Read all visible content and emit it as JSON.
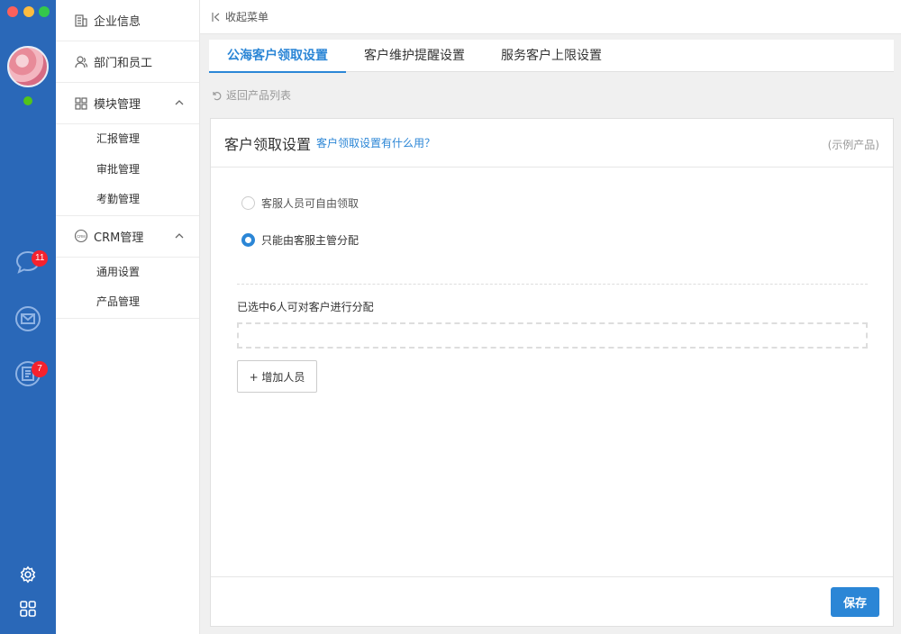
{
  "window": {
    "controls": [
      "close",
      "minimize",
      "zoom"
    ]
  },
  "rail": {
    "icons": [
      {
        "name": "chat-icon",
        "badge": "11"
      },
      {
        "name": "mail-icon",
        "badge": ""
      },
      {
        "name": "notes-icon",
        "badge": "7"
      }
    ],
    "bottom_icons": [
      "gear-icon",
      "apps-grid-icon"
    ],
    "status": "online"
  },
  "menu": {
    "items": [
      {
        "label": "企业信息",
        "icon": "building-icon"
      },
      {
        "label": "部门和员工",
        "icon": "people-icon"
      },
      {
        "label": "模块管理",
        "icon": "modules-icon",
        "expanded": true,
        "children": [
          "汇报管理",
          "审批管理",
          "考勤管理"
        ]
      },
      {
        "label": "CRM管理",
        "icon": "crm-icon",
        "expanded": true,
        "children": [
          "通用设置",
          "产品管理"
        ]
      }
    ]
  },
  "topbar": {
    "collapse_label": "收起菜单"
  },
  "tabs": [
    {
      "label": "公海客户领取设置",
      "active": true
    },
    {
      "label": "客户维护提醒设置",
      "active": false
    },
    {
      "label": "服务客户上限设置",
      "active": false
    }
  ],
  "back": {
    "label": "返回产品列表"
  },
  "card": {
    "title": "客户领取设置",
    "help_link": "客户领取设置有什么用？",
    "example_tag": "(示例产品)",
    "options": [
      {
        "label": "客服人员可自由领取",
        "checked": false
      },
      {
        "label": "只能由客服主管分配",
        "checked": true
      }
    ],
    "selected_text": "已选中6人可对客户进行分配",
    "add_button": "+ 增加人员",
    "save_button": "保存"
  },
  "colors": {
    "rail": "#2a68b8",
    "accent": "#2b86d6",
    "badge": "#f5222d"
  }
}
